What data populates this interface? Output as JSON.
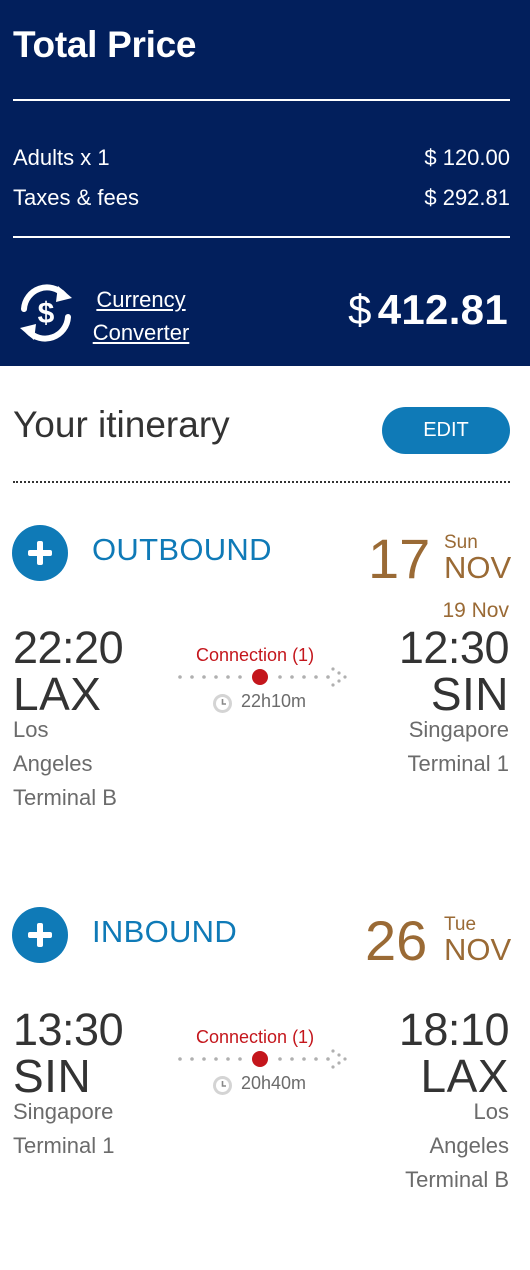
{
  "price": {
    "title": "Total Price",
    "lines": [
      {
        "label": "Adults x 1",
        "amount": "$ 120.00"
      },
      {
        "label": "Taxes & fees",
        "amount": "$ 292.81"
      }
    ],
    "converter": {
      "line1": "Currency",
      "line2": "Converter",
      "icon": "currency-exchange-icon"
    },
    "total_symbol": "$",
    "total_value": "412.81"
  },
  "itinerary": {
    "title": "Your itinerary",
    "edit_label": "EDIT"
  },
  "flights": [
    {
      "direction": "OUTBOUND",
      "day": "17",
      "dow": "Sun",
      "month": "NOV",
      "arrival_date": "19 Nov",
      "dep_time": "22:20",
      "dep_code": "LAX",
      "dep_city_lines": [
        "Los",
        "Angeles",
        "Terminal B"
      ],
      "arr_time": "12:30",
      "arr_code": "SIN",
      "arr_city_lines": [
        "Singapore",
        "Terminal 1"
      ],
      "connection": "Connection (1)",
      "duration": "22h10m"
    },
    {
      "direction": "INBOUND",
      "day": "26",
      "dow": "Tue",
      "month": "NOV",
      "dep_time": "13:30",
      "dep_code": "SIN",
      "dep_city_lines": [
        "Singapore",
        "Terminal 1"
      ],
      "arr_time": "18:10",
      "arr_code": "LAX",
      "arr_city_lines": [
        "Los",
        "Angeles",
        "Terminal B"
      ],
      "connection": "Connection (1)",
      "duration": "20h40m"
    }
  ],
  "colors": {
    "panel_bg": "#021f5c",
    "accent_blue": "#0f7ab7",
    "date_brown": "#9a6a35",
    "connection_red": "#c4161c"
  }
}
